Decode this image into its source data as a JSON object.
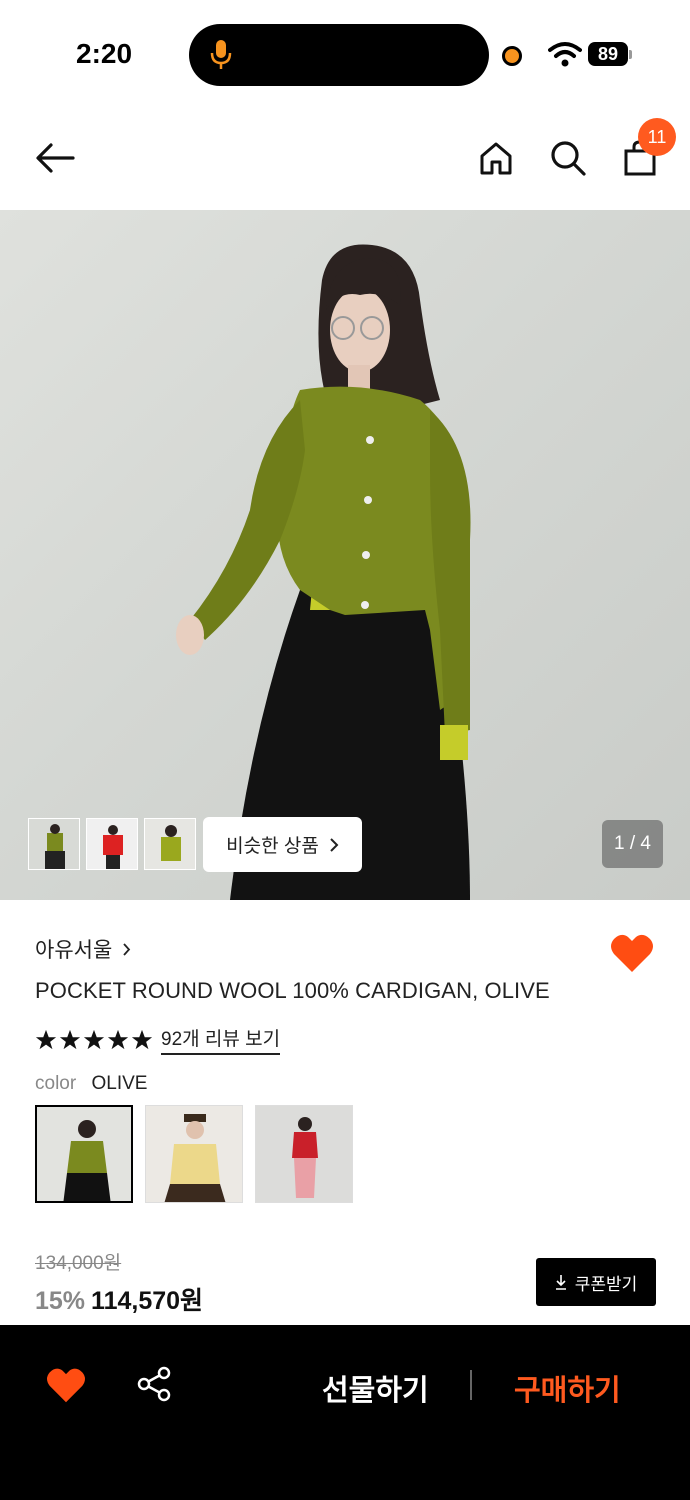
{
  "status_bar": {
    "time": "2:20",
    "battery": "89"
  },
  "nav": {
    "cart_count": "11"
  },
  "hero": {
    "similar_label": "비슷한 상품",
    "page_indicator": "1 / 4"
  },
  "product": {
    "brand": "아유서울",
    "title": "POCKET ROUND WOOL 100% CARDIGAN, OLIVE",
    "rating": 5,
    "review_link": "92개 리뷰 보기",
    "color_label": "color",
    "color_value": "OLIVE",
    "swatches": [
      "olive",
      "yellow",
      "red"
    ],
    "original_price": "134,000원",
    "discount": "15%",
    "price": "114,570원",
    "coupon_label": "쿠폰받기"
  },
  "bottom_bar": {
    "gift_label": "선물하기",
    "buy_label": "구매하기"
  },
  "colors": {
    "accent": "#ff5a1f",
    "heart": "#ff4d12",
    "olive": "#7b8a1f"
  }
}
